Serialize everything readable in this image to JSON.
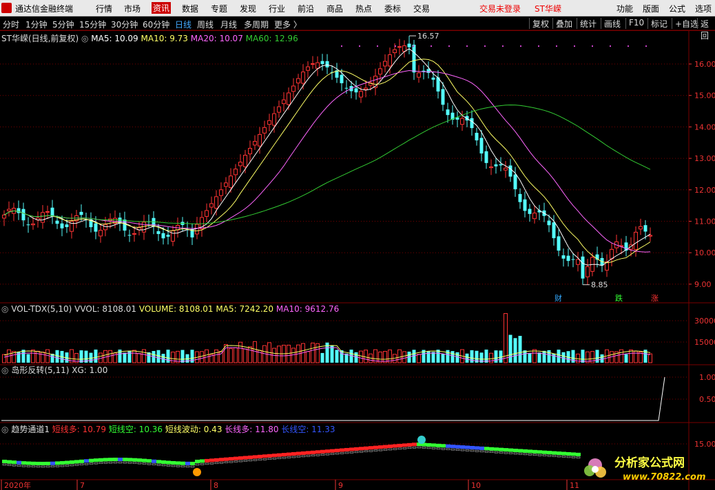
{
  "menubar": {
    "app_name": "通达信金融终端",
    "menus": [
      "行情",
      "市场",
      "资讯",
      "数据",
      "专题",
      "发现",
      "行业",
      "前沿",
      "商品",
      "热点",
      "委标",
      "交易"
    ],
    "active_menu": "资讯",
    "status_login": "交易未登录",
    "stock_name": "ST华嵘",
    "right_menus": [
      "功能",
      "版面",
      "公式",
      "选项"
    ]
  },
  "periodbar": {
    "periods": [
      "分时",
      "1分钟",
      "5分钟",
      "15分钟",
      "30分钟",
      "60分钟",
      "日线",
      "周线",
      "月线",
      "多周期",
      "更多 〉"
    ],
    "active_period": "日线",
    "tools": [
      "复权",
      "叠加",
      "统计",
      "画线",
      "F10",
      "标记",
      "+自选",
      "返回"
    ]
  },
  "price_panel": {
    "title": "ST华嵘(日线,前复权)",
    "ma5": "MA5: 10.09",
    "ma10": "MA10: 9.73",
    "ma20": "MA20: 10.07",
    "ma60": "MA60: 12.96",
    "high_label": "16.57",
    "low_label": "8.85",
    "y_ticks": [
      "16.00",
      "15.00",
      "14.00",
      "13.00",
      "12.00",
      "11.00",
      "10.00",
      "9.00"
    ],
    "markers": [
      "财",
      "跌",
      "涨"
    ]
  },
  "volume_panel": {
    "title": "VOL-TDX(5,10)",
    "vvol": "VVOL: 8108.01",
    "volume": "VOLUME: 8108.01",
    "ma5": "MA5: 7242.20",
    "ma10": "MA10: 9612.76",
    "y_ticks": [
      "30000",
      "15000"
    ]
  },
  "island_panel": {
    "title": "岛形反转(5,11)",
    "xg": "XG: 1.00",
    "y_ticks": [
      "1.00",
      "0.50"
    ]
  },
  "trend_panel": {
    "title": "趋势通道1",
    "short_long": "短线多: 10.79",
    "short_short": "短线空: 10.36",
    "short_wave": "短线波动: 0.43",
    "long_long": "长线多: 11.80",
    "long_short": "长线空: 11.33",
    "y_ticks": [
      "15.00"
    ]
  },
  "xaxis": {
    "labels": [
      "2020年",
      "7",
      "8",
      "9",
      "10",
      "11"
    ]
  },
  "watermark": {
    "title": "分析家公式网",
    "url": "www.70822.com"
  },
  "colors": {
    "up": "#ff3333",
    "down": "#54fcfc",
    "ma5": "#ffffff",
    "ma10": "#ffff66",
    "ma20": "#ff66ff",
    "ma60": "#33cc33",
    "grid": "#7a0000"
  }
}
